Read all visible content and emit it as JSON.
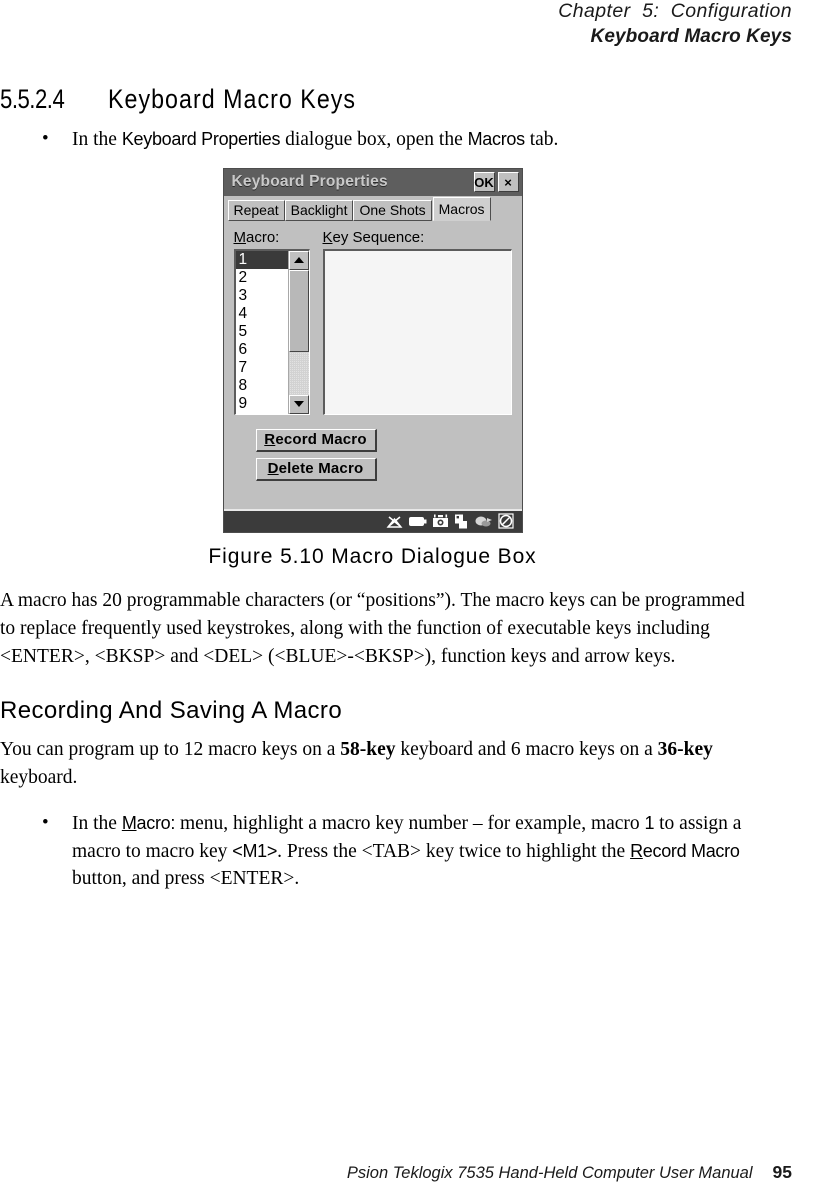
{
  "header": {
    "chapter": "Chapter  5:  Configuration",
    "title": "Keyboard Macro Keys"
  },
  "section": {
    "number": "5.5.2.4",
    "heading": "Keyboard Macro Keys"
  },
  "bullets": {
    "first": {
      "dot": "•",
      "pre": "In the ",
      "ui1": "Keyboard Properties",
      "mid": " dialogue box, open the ",
      "ui2": "Macros",
      "post": " tab."
    },
    "second": {
      "dot": "•",
      "pre": "In the ",
      "ui1_accel": "M",
      "ui1_rest": "acro:",
      "mid1": " menu, highlight a macro key number – for example, macro ",
      "ui2": "1",
      "mid2": " to assign a macro to macro key ",
      "ui3": "<M1>",
      "mid3": ". Press the <TAB> key twice to highlight the ",
      "ui4_accel": "R",
      "ui4_rest": "ecord Macro",
      "post": " button, and press <ENTER>."
    }
  },
  "figure": {
    "caption": "Figure 5.10 Macro Dialogue Box",
    "dialog": {
      "title": "Keyboard Properties",
      "ok_label": "OK",
      "close_label": "×",
      "tabs": [
        {
          "label": "Repeat",
          "active": false
        },
        {
          "label": "Backlight",
          "active": false
        },
        {
          "label": "One Shots",
          "active": false
        },
        {
          "label": "Macros",
          "active": true
        }
      ],
      "macro_label_accel": "M",
      "macro_label_rest": "acro:",
      "key_sequence_label_accel": "K",
      "key_sequence_label_rest": "ey Sequence:",
      "macro_list": [
        "1",
        "2",
        "3",
        "4",
        "5",
        "6",
        "7",
        "8",
        "9"
      ],
      "macro_selected": "1",
      "key_sequence_value": "",
      "buttons": [
        {
          "accel": "R",
          "rest": "ecord Macro"
        },
        {
          "accel": "D",
          "rest": "elete Macro"
        }
      ],
      "taskbar_icons": [
        "antenna-disabled-icon",
        "battery-icon",
        "scanner-icon",
        "device-icon",
        "printer-icon",
        "no-entry-icon"
      ]
    },
    "colors": {
      "dialog_face": "#c0c0c0",
      "titlebar": "#5e5e5e",
      "selection": "#3a3a3a",
      "taskbar": "#3b3b3b"
    }
  },
  "paragraphs": {
    "macro_description": "A macro has 20 programmable characters (or “positions”). The macro keys can be programmed to replace frequently used keystrokes, along with the function of executable keys including <ENTER>, <BKSP> and <DEL> (<BLUE>-<BKSP>), function keys and arrow keys.",
    "recording_heading": "Recording And Saving A Macro",
    "recording_intro_pre": "You can program up to 12 macro keys on a ",
    "recording_intro_b1": "58-key",
    "recording_intro_mid": " keyboard and 6 macro keys on a ",
    "recording_intro_b2": "36-key",
    "recording_intro_post": " keyboard."
  },
  "footer": {
    "manual": "Psion Teklogix 7535 Hand-Held Computer User Manual",
    "page": "95"
  }
}
